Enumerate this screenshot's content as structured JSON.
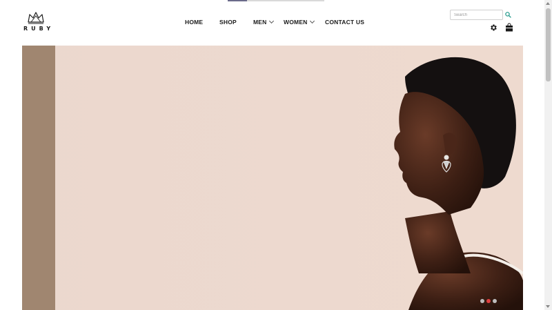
{
  "loading_bar": {
    "progress": 0.2
  },
  "brand": {
    "name": "RUBY",
    "logo_icon": "crown-icon"
  },
  "nav": {
    "items": [
      {
        "label": "HOME",
        "dropdown": false
      },
      {
        "label": "SHOP",
        "dropdown": false
      },
      {
        "label": "MEN",
        "dropdown": true
      },
      {
        "label": "WOMEN",
        "dropdown": true
      },
      {
        "label": "CONTACT US",
        "dropdown": false
      }
    ]
  },
  "search": {
    "placeholder": "Search",
    "value": "",
    "icon": "search-icon"
  },
  "header_icons": {
    "settings": "gear-icon",
    "cart": "shopping-bag-icon"
  },
  "hero": {
    "background": "#ecd8ce",
    "stripe_color": "#a08670",
    "slides": 3,
    "active_slide": 2
  },
  "colors": {
    "accent": "#e04040",
    "search_icon": "#2a9d8f",
    "text": "#1a1a1a"
  }
}
